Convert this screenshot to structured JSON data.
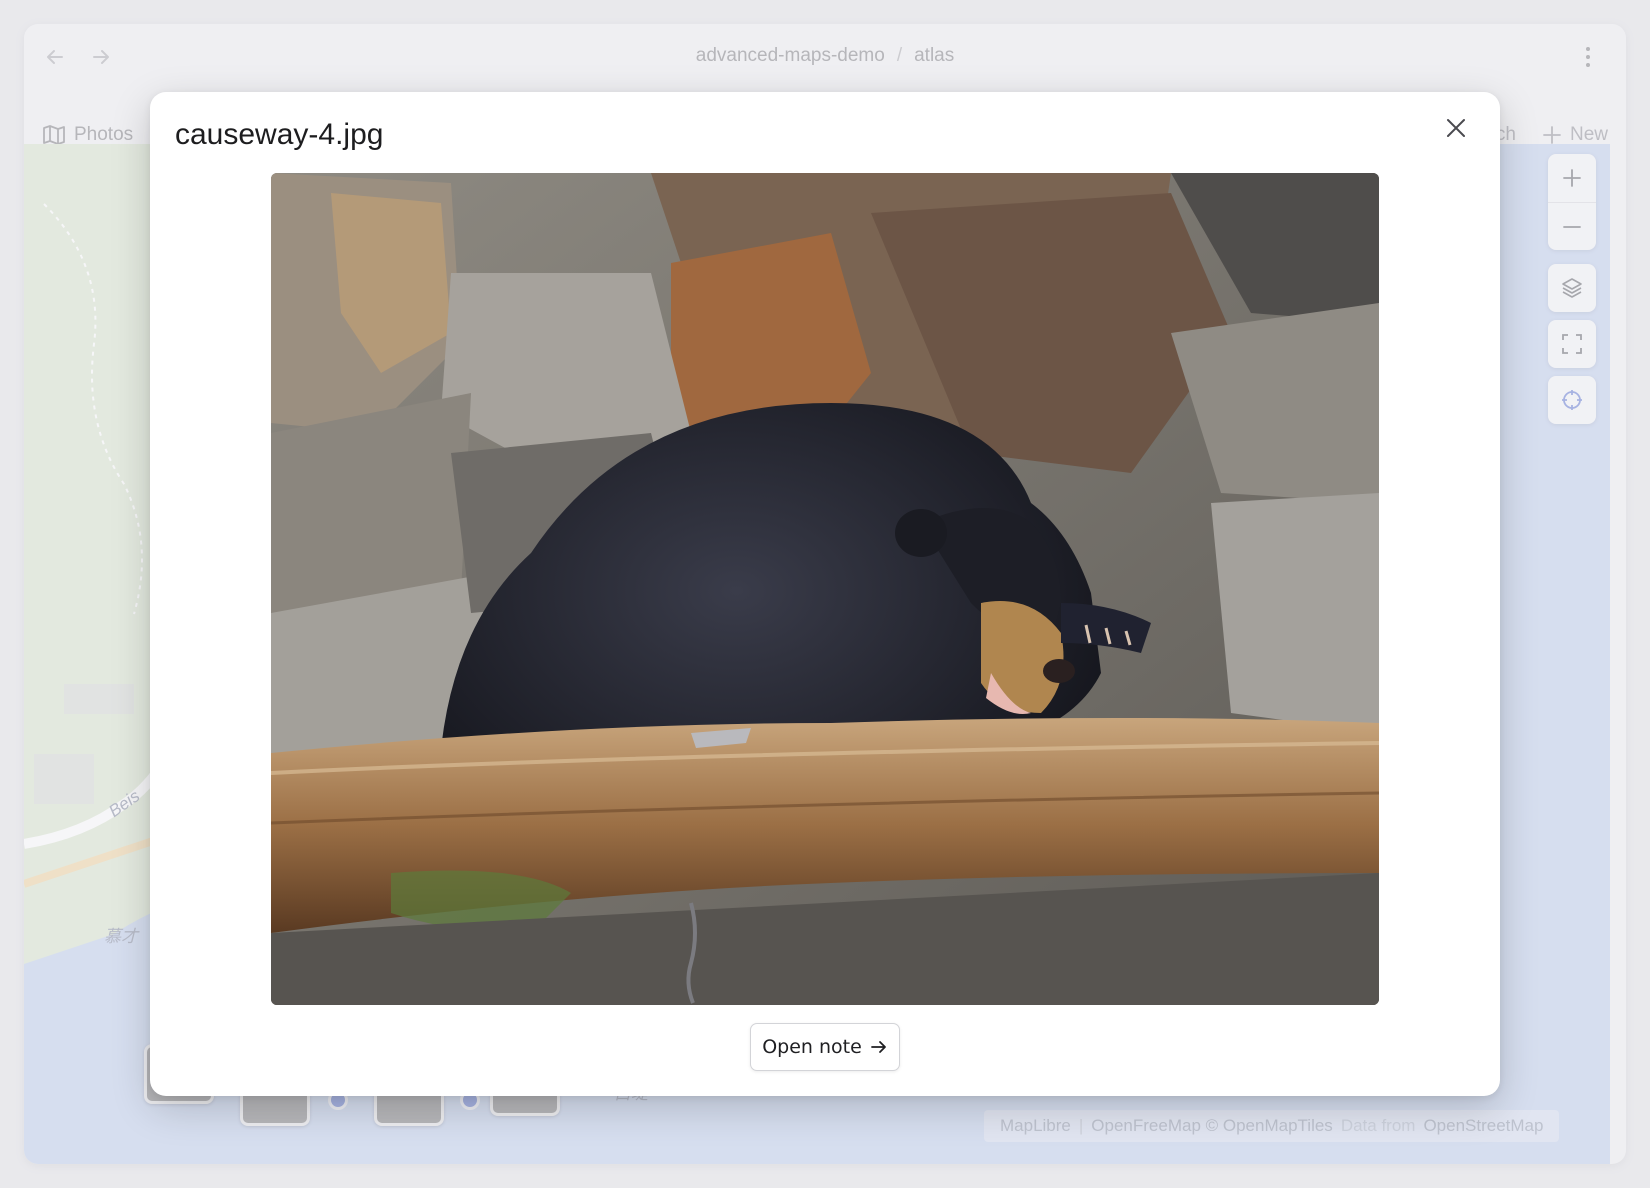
{
  "browser": {
    "breadcrumb": {
      "project": "advanced-maps-demo",
      "separator": "/",
      "page": "atlas"
    }
  },
  "toolbar": {
    "photos_label": "Photos",
    "search_label_partial": "ch",
    "new_label": "New"
  },
  "map": {
    "label_road": "Beis",
    "label_place": "慕才",
    "label_causeway": "白堤",
    "attribution": {
      "maplibre": "MapLibre",
      "separator": "|",
      "openfreemap": "OpenFreeMap © OpenMapTiles",
      "data_from": "Data from",
      "osm": "OpenStreetMap"
    },
    "controls": [
      "zoom-in",
      "zoom-out",
      "layers",
      "fullscreen",
      "locate"
    ]
  },
  "modal": {
    "title": "causeway-4.jpg",
    "open_note_label": "Open note"
  },
  "colors": {
    "map_water": "#c5d3ef",
    "map_land": "#dde8d2",
    "marker": "#6f86d8",
    "modal_bg": "#ffffff"
  }
}
